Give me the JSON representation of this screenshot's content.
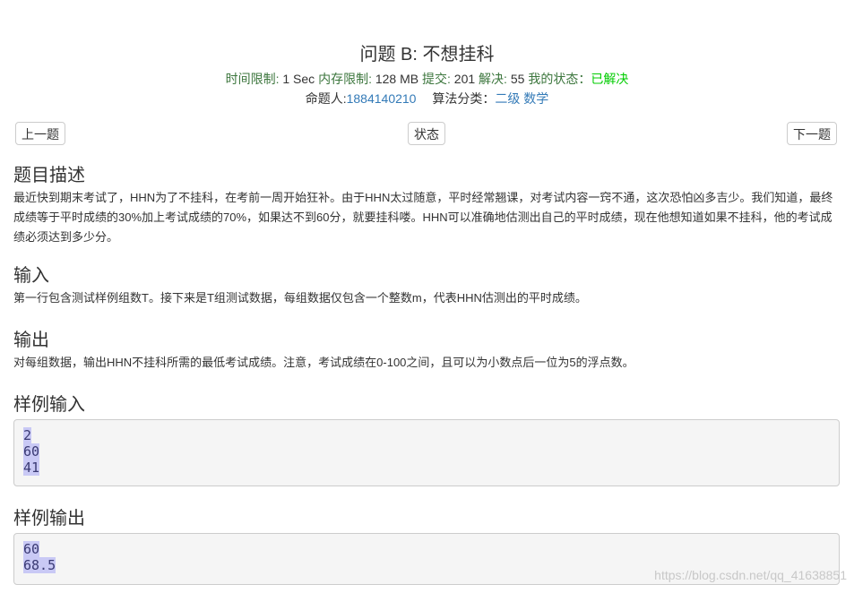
{
  "problem": {
    "title": "问题 B: 不想挂科",
    "time_limit_label": "时间限制:",
    "time_limit_value": "1 Sec",
    "memory_limit_label": "内存限制:",
    "memory_limit_value": "128 MB",
    "submit_label": "提交:",
    "submit_value": "201",
    "solved_label": "解决:",
    "solved_value": "55",
    "my_status_label": "我的状态：",
    "my_status_value": "已解决",
    "author_label": "命题人:",
    "author_value": "1884140210",
    "category_label": "算法分类：",
    "category_level": "二级",
    "category_topic": "数学"
  },
  "nav": {
    "prev_label": "上一题",
    "status_label": "状态",
    "next_label": "下一题"
  },
  "sections": {
    "description_heading": "题目描述",
    "description_text": "最近快到期末考试了，HHN为了不挂科，在考前一周开始狂补。由于HHN太过随意，平时经常翘课，对考试内容一窍不通，这次恐怕凶多吉少。我们知道，最终成绩等于平时成绩的30%加上考试成绩的70%，如果达不到60分，就要挂科喽。HHN可以准确地估测出自己的平时成绩，现在他想知道如果不挂科，他的考试成绩必须达到多少分。",
    "input_heading": "输入",
    "input_text": "第一行包含测试样例组数T。接下来是T组测试数据，每组数据仅包含一个整数m，代表HHN估测出的平时成绩。",
    "output_heading": "输出",
    "output_text": "对每组数据，输出HHN不挂科所需的最低考试成绩。注意，考试成绩在0-100之间，且可以为小数点后一位为5的浮点数。",
    "sample_input_heading": "样例输入",
    "sample_input_lines": [
      "2",
      "60",
      "41"
    ],
    "sample_output_heading": "样例输出",
    "sample_output_lines": [
      "60",
      "68.5"
    ]
  },
  "watermark": "https://blog.csdn.net/qq_41638851",
  "colors": {
    "label_green": "#3c763d",
    "solved_green": "#00cc00",
    "link_blue": "#337ab7",
    "pre_background": "#f5f5f5",
    "selection_highlight": "#c9c9f5"
  }
}
